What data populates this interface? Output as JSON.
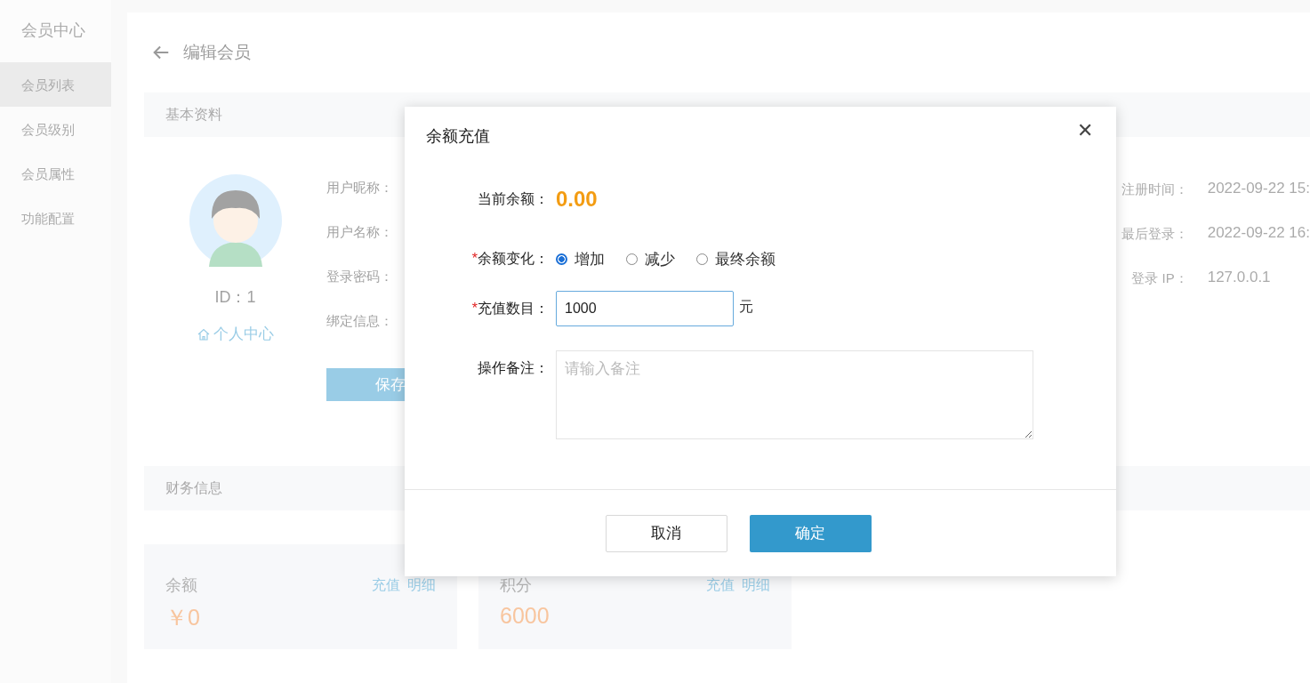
{
  "sidebar": {
    "title": "会员中心",
    "items": [
      {
        "label": "会员列表",
        "selected": true
      },
      {
        "label": "会员级别",
        "selected": false
      },
      {
        "label": "会员属性",
        "selected": false
      },
      {
        "label": "功能配置",
        "selected": false
      }
    ]
  },
  "page": {
    "title": "编辑会员",
    "basic": {
      "title": "基本资料",
      "id_text": "ID：1",
      "home_link": "个人中心",
      "fields": [
        "用户昵称：",
        "用户名称：",
        "登录密码：",
        "绑定信息："
      ],
      "save_button": "保存",
      "info": [
        {
          "label": "注册时间：",
          "value": "2022-09-22 15:"
        },
        {
          "label": "最后登录：",
          "value": "2022-09-22 16:"
        },
        {
          "label": "登录 IP：",
          "value": "127.0.0.1"
        }
      ]
    },
    "finance": {
      "title": "财务信息",
      "cards": [
        {
          "label": "余额",
          "actions": [
            "充值",
            "明细"
          ],
          "value": "￥0"
        },
        {
          "label": "积分",
          "actions": [
            "充值",
            "明细"
          ],
          "value": "6000"
        }
      ]
    }
  },
  "dialog": {
    "title": "余额充值",
    "close": "✕",
    "balance": {
      "label": "当前余额：",
      "value": "0.00"
    },
    "change": {
      "mark": "*",
      "label": "余额变化：",
      "options": [
        {
          "label": "增加",
          "selected": true
        },
        {
          "label": "减少",
          "selected": false
        },
        {
          "label": "最终余额",
          "selected": false
        }
      ]
    },
    "amount": {
      "mark": "*",
      "label": "充值数目：",
      "value": "1000",
      "unit": "元"
    },
    "note": {
      "label": "操作备注：",
      "placeholder": "请输入备注"
    },
    "buttons": {
      "cancel": "取消",
      "confirm": "确定"
    }
  }
}
